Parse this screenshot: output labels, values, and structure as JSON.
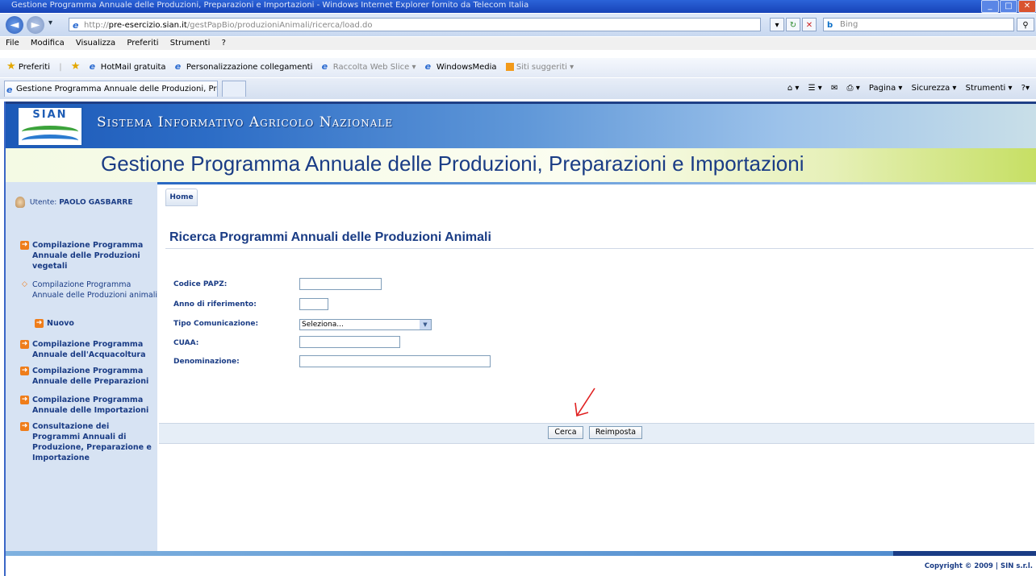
{
  "browser": {
    "window_title": "Gestione Programma Annuale delle Produzioni, Preparazioni e Importazioni - Windows Internet Explorer fornito da Telecom Italia",
    "address_domain": "pre-esercizio.sian.it",
    "address_path": "/gestPapBio/produzioniAnimali/ricerca/load.do",
    "address_prefix": "http://",
    "search_placeholder": "Bing",
    "menu": [
      "File",
      "Modifica",
      "Visualizza",
      "Preferiti",
      "Strumenti",
      "?"
    ],
    "favorites_label": "Preferiti",
    "favorites": [
      "HotMail gratuita",
      "Personalizzazione collegamenti",
      "Raccolta Web Slice ▾",
      "WindowsMedia",
      "Siti suggeriti ▾"
    ],
    "tab_title": "Gestione Programma Annuale delle Produzioni, Prepar...",
    "commands": [
      "Pagina ▾",
      "Sicurezza ▾",
      "Strumenti ▾"
    ]
  },
  "header": {
    "logo_text": "SIAN",
    "system_name": "Sistema Informativo Agricolo Nazionale",
    "app_title": "Gestione Programma Annuale delle Produzioni, Preparazioni e Importazioni"
  },
  "sidebar": {
    "user_label": "Utente:",
    "user_name": "PAOLO GASBARRE",
    "items": [
      {
        "label": "Compilazione Programma Annuale delle Produzioni vegetali"
      },
      {
        "label": "Compilazione Programma Annuale delle Produzioni animali"
      },
      {
        "label": "Nuovo"
      },
      {
        "label": "Compilazione Programma Annuale dell'Acquacoltura"
      },
      {
        "label": "Compilazione Programma Annuale delle Preparazioni"
      },
      {
        "label": "Compilazione Programma Annuale delle Importazioni"
      },
      {
        "label": "Consultazione dei Programmi Annuali di Produzione, Preparazione e Importazione"
      }
    ]
  },
  "content": {
    "home_tab": "Home",
    "page_title": "Ricerca Programmi Annuali delle Produzioni Animali",
    "fields": {
      "codice_papz": "Codice PAPZ:",
      "anno": "Anno di riferimento:",
      "tipo": "Tipo Comunicazione:",
      "tipo_value": "Seleziona...",
      "cuaa": "CUAA:",
      "denominazione": "Denominazione:"
    },
    "buttons": {
      "cerca": "Cerca",
      "reimposta": "Reimposta"
    },
    "copyright": "Copyright © 2009 | SIN s.r.l."
  },
  "colors": {
    "accent": "#1a3c85",
    "arrow_annotation": "#e02020",
    "menu_bullet": "#ef7d1a"
  }
}
